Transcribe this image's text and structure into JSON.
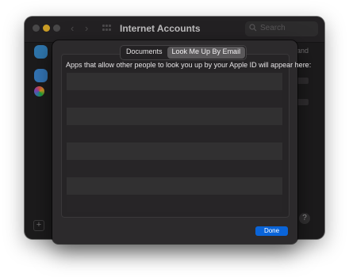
{
  "window": {
    "title": "Internet Accounts",
    "search_placeholder": "Search",
    "background_tail_text": "and",
    "add_label": "+",
    "help_label": "?"
  },
  "sheet": {
    "tabs": [
      {
        "label": "Documents",
        "selected": false
      },
      {
        "label": "Look Me Up By Email",
        "selected": true
      }
    ],
    "description": "Apps that allow other people to look you up by your Apple ID will appear here:",
    "list_rows": 8,
    "done_label": "Done"
  },
  "colors": {
    "accent": "#0a64d8",
    "minimize_light": "#f7c02f"
  }
}
